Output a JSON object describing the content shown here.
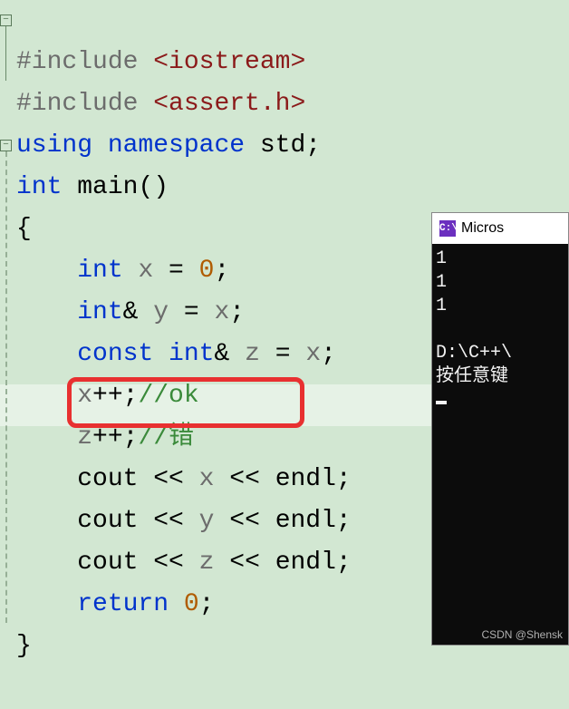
{
  "code": {
    "l1": {
      "dir": "#include ",
      "hdr": "<iostream>"
    },
    "l2": {
      "dir": "#include ",
      "hdr": "<assert.h>"
    },
    "l3": {
      "kw1": "using ",
      "kw2": "namespace ",
      "id": "std",
      ";": ";"
    },
    "l4": {
      "kw": "int ",
      "fn": "main",
      "paren": "()"
    },
    "l5": "{",
    "l6": {
      "kw": "int ",
      "id": "x",
      " = ": " = ",
      "num": "0",
      ";": ";"
    },
    "l7": {
      "kw": "int",
      "amp": "& ",
      "id": "y",
      " = ": " = ",
      "rhs": "x",
      ";": ";"
    },
    "l8": {
      "kw1": "const ",
      "kw2": "int",
      "amp": "& ",
      "id": "z",
      " = ": " = ",
      "rhs": "x",
      ";": ";"
    },
    "l9": {
      "id": "x",
      "op": "++;",
      "cmt": "//ok"
    },
    "l10": {
      "id": "z",
      "op": "++;",
      "cmt": "//错"
    },
    "l11": {
      "id": "cout",
      "a": " << ",
      "v": "x",
      "b": " << ",
      "e": "endl",
      ";": ";"
    },
    "l12": {
      "id": "cout",
      "a": " << ",
      "v": "y",
      "b": " << ",
      "e": "endl",
      ";": ";"
    },
    "l13": {
      "id": "cout",
      "a": " << ",
      "v": "z",
      "b": " << ",
      "e": "endl",
      ";": ";"
    },
    "l14": {
      "kw": "return ",
      "num": "0",
      ";": ";"
    },
    "l15": "}"
  },
  "fold": {
    "minus": "⊟"
  },
  "console": {
    "title": "Micros",
    "icon": "C:\\",
    "out1": "1",
    "out2": "1",
    "out3": "1",
    "path": "D:\\C++\\",
    "prompt": "按任意键"
  },
  "watermark": "CSDN @Shensk"
}
